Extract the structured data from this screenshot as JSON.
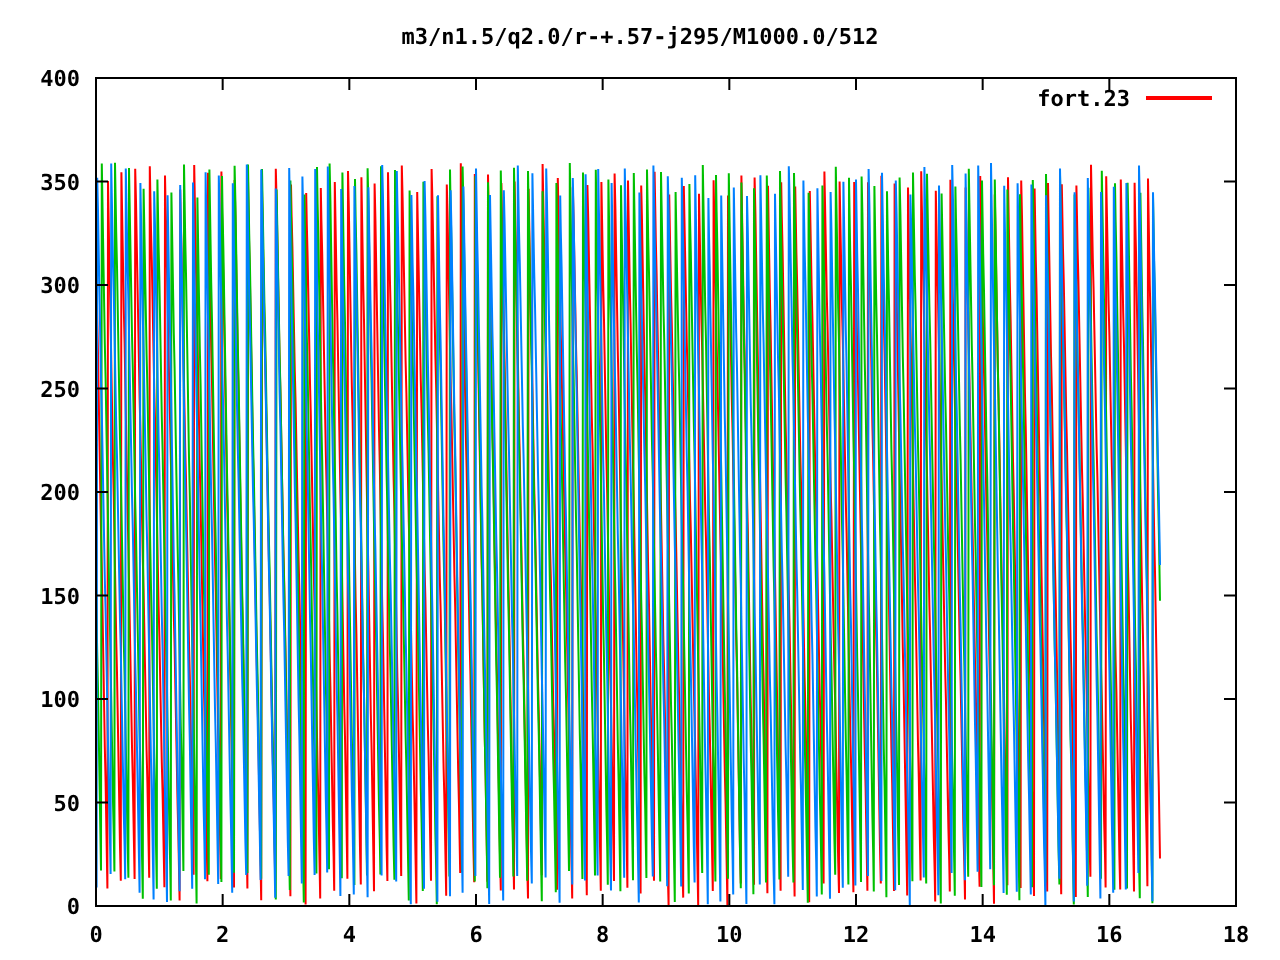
{
  "plot": {
    "title": "m3/n1.5/q2.0/r-+.57-j295/M1000.0/512",
    "y_tick_labels": [
      "400",
      "350",
      "300",
      "250",
      "200",
      "150",
      "100",
      "50",
      "0"
    ],
    "x_tick_labels": [
      "0",
      "2",
      "4",
      "6",
      "8",
      "10",
      "12",
      "14",
      "16",
      "18"
    ],
    "legend": {
      "label": "fort.23",
      "color": "#ff0000"
    }
  }
}
